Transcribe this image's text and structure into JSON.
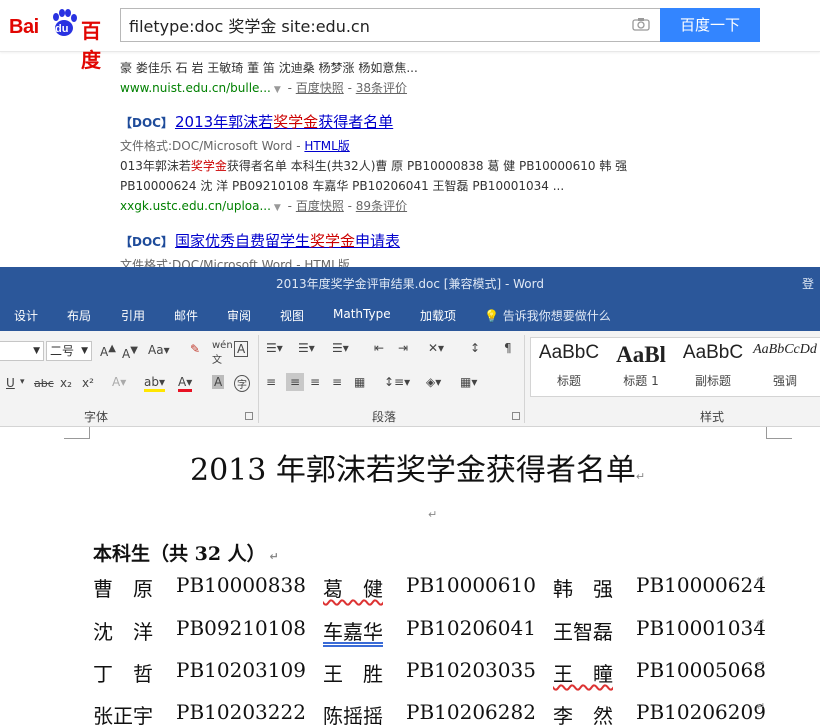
{
  "baidu": {
    "logo": {
      "bai": "Bai",
      "du": "du",
      "cn": "百度"
    },
    "search": {
      "value": "filetype:doc 奖学金 site:edu.cn",
      "button": "百度一下",
      "camera_icon": "camera-icon"
    },
    "results": [
      {
        "snippet": "豪 娄佳乐 石 岩 王敏琦 董 笛 沈迪桑 杨梦涨 杨如意焦...",
        "url": "www.nuist.edu.cn/bulle...",
        "cache": "百度快照",
        "reviews": "38条评价"
      },
      {
        "tag": "【DOC】",
        "title_pre": "2013年郭沫若",
        "title_hl": "奖学金",
        "title_post": "获得者名单",
        "format_label": "文件格式:DOC/Microsoft Word - ",
        "format_link": "HTML版",
        "snippet1_pre": "013年郭沫若",
        "snippet1_hl": "奖学金",
        "snippet1_post": "获得者名单 本科生(共32人)曹 原 PB10000838 葛 健 PB10000610 韩 强",
        "snippet2": "PB10000624 沈 洋 PB09210108 车嘉华 PB10206041 王智磊 PB10001034 ...",
        "url": "xxgk.ustc.edu.cn/uploa...",
        "cache": "百度快照",
        "reviews": "89条评价"
      },
      {
        "tag": "【DOC】",
        "title_pre": "国家优秀自费留学生",
        "title_hl": "奖学金",
        "title_post": "申请表",
        "format_label": "文件格式:DOC/Microsoft Word - HTML版"
      }
    ]
  },
  "word": {
    "window_title": "2013年度奖学金评审结果.doc [兼容模式] - Word",
    "login_cut": "登",
    "tabs": [
      "设计",
      "布局",
      "引用",
      "邮件",
      "审阅",
      "视图",
      "MathType",
      "加载项"
    ],
    "tell_me": "告诉我你想要做什么",
    "font_size": "二号",
    "groups": {
      "font": "字体",
      "paragraph": "段落",
      "styles": "样式"
    },
    "styles": [
      {
        "preview": "AaBbC",
        "name": "标题"
      },
      {
        "preview": "AaBl",
        "name": "标题 1"
      },
      {
        "preview": "AaBbC",
        "name": "副标题"
      },
      {
        "preview": "AaBbCcDd",
        "name": "强调"
      }
    ],
    "doc": {
      "title": "2013 年郭沫若奖学金获得者名单",
      "subtitle": "本科生（共 32 人）",
      "rows": [
        [
          [
            "曹　原",
            "PB10000838"
          ],
          [
            "葛　健",
            "PB10000610"
          ],
          [
            "韩　强",
            "PB10000624"
          ]
        ],
        [
          [
            "沈　洋",
            "PB09210108"
          ],
          [
            "车嘉华",
            "PB10206041"
          ],
          [
            "王智磊",
            "PB10001034"
          ]
        ],
        [
          [
            "丁　哲",
            "PB10203109"
          ],
          [
            "王　胜",
            "PB10203035"
          ],
          [
            "王　瞳",
            "PB10005068"
          ]
        ],
        [
          [
            "张正宇",
            "PB10203222"
          ],
          [
            "陈摇摇",
            "PB10206282"
          ],
          [
            "李　然",
            "PB10206209"
          ]
        ]
      ]
    }
  },
  "colors": {
    "baidu_blue": "#3385ff",
    "baidu_red": "#e10602",
    "word_blue": "#2b579a"
  }
}
